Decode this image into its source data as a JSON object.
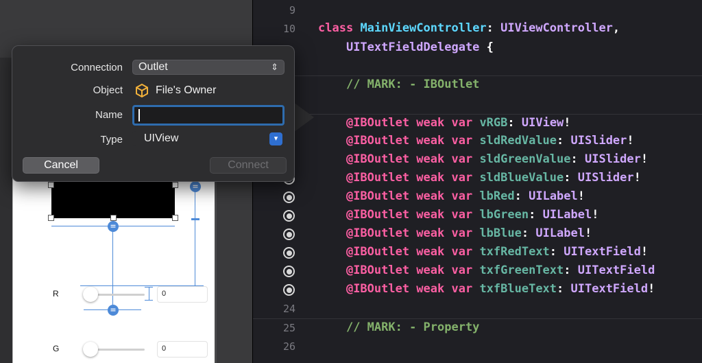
{
  "popover": {
    "connection_label": "Connection",
    "connection_value": "Outlet",
    "object_label": "Object",
    "object_value": "File's Owner",
    "name_label": "Name",
    "name_value": "",
    "type_label": "Type",
    "type_value": "UIView",
    "cancel_label": "Cancel",
    "connect_label": "Connect"
  },
  "canvas": {
    "r_label": "R",
    "g_label": "G",
    "r_field": "0",
    "g_field": "0"
  },
  "editor": {
    "lines": [
      {
        "num": "9",
        "code": ""
      },
      {
        "num": "10",
        "code": "class MainViewController: UIViewController,"
      },
      {
        "num": "",
        "code": "    UITextFieldDelegate {"
      },
      {
        "num": "",
        "code": ""
      },
      {
        "num": "",
        "code": "    // MARK: - IBOutlet"
      },
      {
        "num": "",
        "code": ""
      },
      {
        "num": "",
        "code": "    @IBOutlet weak var vRGB: UIView!"
      },
      {
        "num": "",
        "code": "    @IBOutlet weak var sldRedValue: UISlider!"
      },
      {
        "num": "",
        "code": "    @IBOutlet weak var sldGreenValue: UISlider!"
      },
      {
        "num": "",
        "code": "    @IBOutlet weak var sldBlueValue: UISlider!"
      },
      {
        "num": "",
        "code": "    @IBOutlet weak var lbRed: UILabel!"
      },
      {
        "num": "",
        "code": "    @IBOutlet weak var lbGreen: UILabel!"
      },
      {
        "num": "",
        "code": "    @IBOutlet weak var lbBlue: UILabel!"
      },
      {
        "num": "",
        "code": "    @IBOutlet weak var txfRedText: UITextField!"
      },
      {
        "num": "",
        "code": "    @IBOutlet weak var txfGreenText: UITextField"
      },
      {
        "num": "",
        "code": "    @IBOutlet weak var txfBlueText: UITextField!"
      },
      {
        "num": "24",
        "code": ""
      },
      {
        "num": "25",
        "code": "    // MARK: - Property"
      },
      {
        "num": "26",
        "code": ""
      }
    ]
  },
  "colors": {
    "keyword": "#fc5fa3",
    "class_name": "#5dd8ff",
    "type_name": "#d0a8ff",
    "comment": "#84b26b",
    "variable": "#67b7a4",
    "accent": "#2e6cae"
  },
  "icons": {
    "object": "cube-icon",
    "select_arrow": "chevron-updown-icon",
    "combo_arrow": "chevron-down-icon",
    "outlet": "outlet-connection-icon"
  }
}
